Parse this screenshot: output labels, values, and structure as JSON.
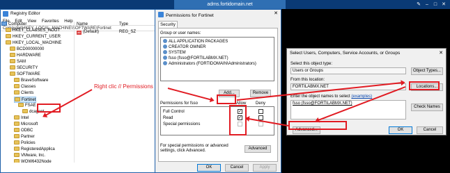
{
  "rdp": {
    "title": "adms.fortidomain.net",
    "pin": "✎",
    "min": "–",
    "max": "□",
    "close": "✕"
  },
  "regedit": {
    "title": "Registry Editor",
    "menu": [
      "File",
      "Edit",
      "View",
      "Favorites",
      "Help"
    ],
    "address": "Computer\\HKEY_LOCAL_MACHINE\\SOFTWARE\\Fortinet",
    "tree": [
      {
        "label": "Computer",
        "type": "computer"
      },
      {
        "label": "HKEY_CLASSES_ROOT",
        "type": "folder"
      },
      {
        "label": "HKEY_CURRENT_USER",
        "type": "folder"
      },
      {
        "label": "HKEY_LOCAL_MACHINE",
        "type": "folder"
      },
      {
        "label": "BCD00000000",
        "type": "folder"
      },
      {
        "label": "HARDWARE",
        "type": "folder"
      },
      {
        "label": "SAM",
        "type": "folder"
      },
      {
        "label": "SECURITY",
        "type": "folder"
      },
      {
        "label": "SOFTWARE",
        "type": "folder"
      },
      {
        "label": "BraveSoftware",
        "type": "folder"
      },
      {
        "label": "Classes",
        "type": "folder"
      },
      {
        "label": "Clients",
        "type": "folder"
      },
      {
        "label": "Fortinet",
        "type": "folder",
        "selected": true
      },
      {
        "label": "FSAE",
        "type": "folder"
      },
      {
        "label": "dcagent",
        "type": "folder"
      },
      {
        "label": "Intel",
        "type": "folder"
      },
      {
        "label": "Microsoft",
        "type": "folder"
      },
      {
        "label": "ODBC",
        "type": "folder"
      },
      {
        "label": "Partner",
        "type": "folder"
      },
      {
        "label": "Policies",
        "type": "folder"
      },
      {
        "label": "RegisteredApplica",
        "type": "folder"
      },
      {
        "label": "VMware, Inc.",
        "type": "folder"
      },
      {
        "label": "WOW6432Node",
        "type": "folder"
      }
    ],
    "columns": {
      "name": "Name",
      "type": "Type"
    },
    "values": [
      {
        "name": "(Default)",
        "type": "REG_SZ"
      }
    ]
  },
  "perm": {
    "title": "Permissions for Fortinet",
    "close": "✕",
    "tab": "Security",
    "group_label": "Group or user names:",
    "users": [
      "ALL APPLICATION PACKAGES",
      "CREATOR OWNER",
      "SYSTEM",
      "fsso (fsso@FORTILABMX.NET)",
      "Administrators (FORTIDOMAIN\\Administrators)"
    ],
    "add": "Add...",
    "remove": "Remove",
    "perm_for": "Permissions for fsso",
    "allow": "Allow",
    "deny": "Deny",
    "perms": [
      {
        "name": "Full Control",
        "allow": true,
        "deny": false
      },
      {
        "name": "Read",
        "allow": true,
        "deny": false
      },
      {
        "name": "Special permissions",
        "allow": false,
        "deny": false
      }
    ],
    "special_note": "For special permissions or advanced settings, click Advanced.",
    "advanced": "Advanced",
    "ok": "OK",
    "cancel": "Cancel",
    "apply": "Apply"
  },
  "seldlg": {
    "title": "Select Users, Computers, Service Accounts, or Groups",
    "close": "✕",
    "type_label": "Select this object type:",
    "type_value": "Users or Groups",
    "object_types": "Object Types...",
    "location_label": "From this location:",
    "location_value": "FORTILABMX.NET",
    "locations": "Locations...",
    "names_label": "Enter the object names to select",
    "examples": "(examples)",
    "names_value": "fsso (fsso@FORTILABMX.NET)",
    "check_names": "Check Names",
    "advanced": "Advanced...",
    "ok": "OK",
    "cancel": "Cancel"
  },
  "annotation": {
    "text": "Right clic // Permissions"
  },
  "colors": {
    "annotation": "#e11b22",
    "titlebar": "#0a3a75",
    "selection": "#cce4f7"
  }
}
